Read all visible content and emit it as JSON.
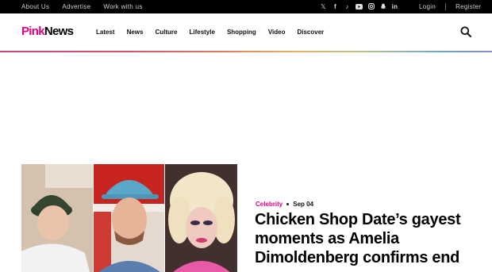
{
  "topbar": {
    "links": [
      "About Us",
      "Advertise",
      "Work with us"
    ],
    "social_icons": [
      "x-icon",
      "facebook-icon",
      "tiktok-icon",
      "youtube-icon",
      "instagram-icon",
      "snapchat-icon",
      "linkedin-icon"
    ],
    "login_label": "Login",
    "register_label": "Register"
  },
  "header": {
    "logo_part1": "Pink",
    "logo_part2": "News",
    "nav": [
      "Latest",
      "News",
      "Culture",
      "Lifestyle",
      "Shopping",
      "Video",
      "Discover"
    ],
    "search_icon": "search-icon"
  },
  "colors": {
    "brand_pink": "#e5007e",
    "topbar_bg": "#000000"
  },
  "article": {
    "category": "Celebrity",
    "date": "Sep 04",
    "headline": "Chicken Shop Date’s gayest moments as Amelia Dimoldenberg confirms end"
  }
}
